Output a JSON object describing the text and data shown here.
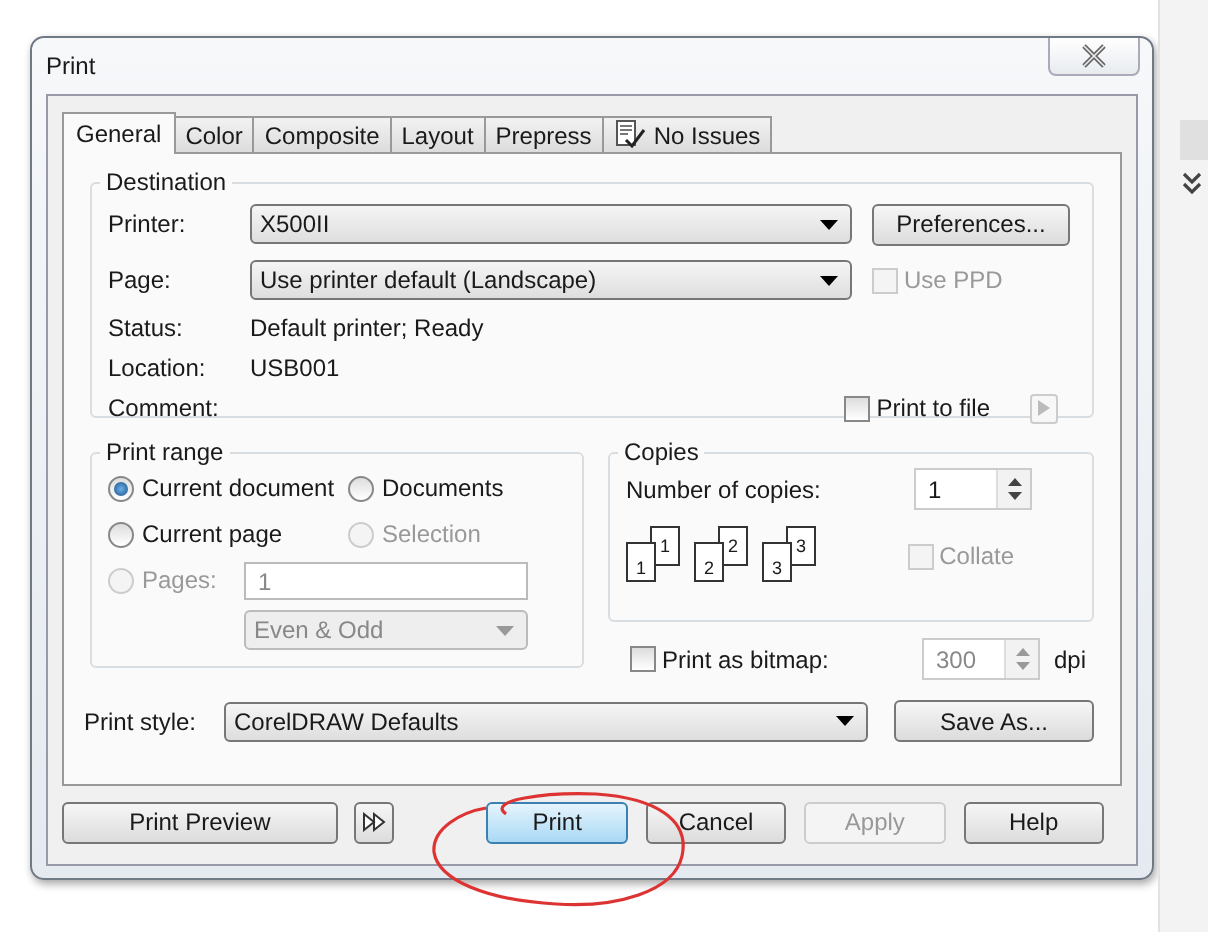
{
  "window": {
    "title": "Print"
  },
  "tabs": [
    {
      "label": "General",
      "selected": true,
      "kind": "plain"
    },
    {
      "label": "Color",
      "selected": false,
      "kind": "plain"
    },
    {
      "label": "Composite",
      "selected": false,
      "kind": "plain"
    },
    {
      "label": "Layout",
      "selected": false,
      "kind": "plain"
    },
    {
      "label": "Prepress",
      "selected": false,
      "kind": "plain"
    },
    {
      "label": "No Issues",
      "selected": false,
      "kind": "issues"
    }
  ],
  "destination": {
    "title": "Destination",
    "printer": {
      "label": "Printer:",
      "value": "X500II"
    },
    "preferences_button": "Preferences...",
    "page": {
      "label": "Page:",
      "value": "Use printer default (Landscape)"
    },
    "use_ppd": {
      "label": "Use PPD",
      "checked": false,
      "disabled": true
    },
    "status": {
      "label": "Status:",
      "value": "Default printer; Ready"
    },
    "location": {
      "label": "Location:",
      "value": "USB001"
    },
    "comment": {
      "label": "Comment:"
    },
    "print_to_file": {
      "label": "Print to file",
      "checked": false
    }
  },
  "print_range": {
    "title": "Print range",
    "options": [
      {
        "label": "Current document",
        "selected": true,
        "disabled": false
      },
      {
        "label": "Documents",
        "selected": false,
        "disabled": false
      },
      {
        "label": "Current page",
        "selected": false,
        "disabled": false
      },
      {
        "label": "Selection",
        "selected": false,
        "disabled": true
      },
      {
        "label": "Pages:",
        "selected": false,
        "disabled": true
      }
    ],
    "pages_value": "1",
    "page_set": {
      "value": "Even & Odd",
      "disabled": true
    }
  },
  "copies": {
    "title": "Copies",
    "label": "Number of copies:",
    "value": "1",
    "stacks": [
      {
        "back": "1",
        "front": "1"
      },
      {
        "back": "2",
        "front": "2"
      },
      {
        "back": "3",
        "front": "3"
      }
    ],
    "collate": {
      "label": "Collate",
      "checked": false,
      "disabled": true
    }
  },
  "bitmap": {
    "label": "Print as bitmap:",
    "checked": false,
    "value": "300",
    "unit": "dpi"
  },
  "print_style": {
    "label": "Print style:",
    "value": "CorelDRAW Defaults"
  },
  "save_as_button": "Save As...",
  "buttons": [
    {
      "kind": "text",
      "label": "Print Preview",
      "disabled": false,
      "default": false
    },
    {
      "kind": "expand"
    },
    {
      "kind": "text",
      "label": "Print",
      "disabled": false,
      "default": true
    },
    {
      "kind": "text",
      "label": "Cancel",
      "disabled": false,
      "default": false
    },
    {
      "kind": "text",
      "label": "Apply",
      "disabled": true,
      "default": false
    },
    {
      "kind": "text",
      "label": "Help",
      "disabled": false,
      "default": false
    }
  ]
}
